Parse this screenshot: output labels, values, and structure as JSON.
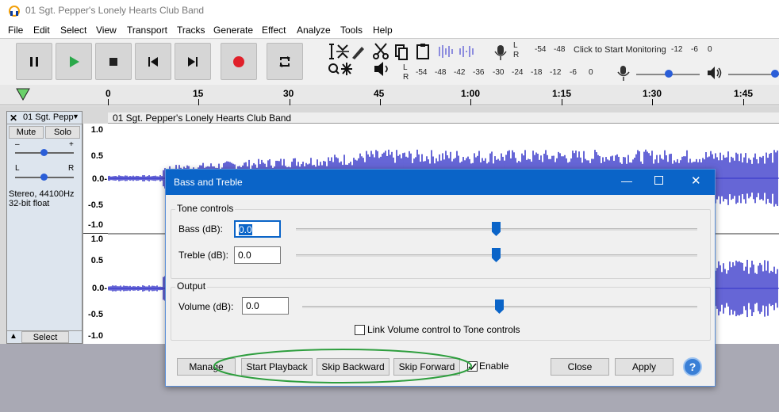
{
  "app": {
    "title": "01 Sgt. Pepper's Lonely Hearts Club Band"
  },
  "menu": [
    "File",
    "Edit",
    "Select",
    "View",
    "Transport",
    "Tracks",
    "Generate",
    "Effect",
    "Analyze",
    "Tools",
    "Help"
  ],
  "transport": {
    "pause": "pause-icon",
    "play": "play-icon",
    "stop": "stop-icon",
    "skip_start": "skip-to-start-icon",
    "skip_end": "skip-to-end-icon",
    "record": "record-icon",
    "loop": "loop-icon"
  },
  "meters": {
    "record_scale": [
      "L",
      "R",
      "-54",
      "-48"
    ],
    "monitor_text": "Click to Start Monitoring",
    "record_scale_right": [
      "-12",
      "-6",
      "0"
    ],
    "playback_scale": [
      "L",
      "R",
      "-54",
      "-48",
      "-42",
      "-36",
      "-30",
      "-24",
      "-18",
      "-12",
      "-6",
      "0"
    ]
  },
  "ruler": {
    "labels": [
      "0",
      "15",
      "30",
      "45",
      "1:00",
      "1:15",
      "1:30",
      "1:45"
    ]
  },
  "track": {
    "name": "01 Sgt. Pepp",
    "mute": "Mute",
    "solo": "Solo",
    "gain_minus": "–",
    "gain_plus": "+",
    "pan_l": "L",
    "pan_r": "R",
    "info_line1": "Stereo, 44100Hz",
    "info_line2": "32-bit float",
    "select": "Select",
    "clip_name": "01 Sgt. Pepper's Lonely Hearts Club Band",
    "scale_ch1": [
      "1.0",
      "0.5",
      "0.0-",
      "-0.5",
      "-1.0"
    ],
    "scale_ch2": [
      "1.0",
      "0.5",
      "0.0-",
      "-0.5",
      "-1.0"
    ]
  },
  "dialog": {
    "title": "Bass and Treble",
    "tone_group": "Tone controls",
    "bass_label": "Bass (dB):",
    "bass_value": "0.0",
    "treble_label": "Treble (dB):",
    "treble_value": "0.0",
    "output_group": "Output",
    "volume_label": "Volume (dB):",
    "volume_value": "0.0",
    "link_label": "Link Volume control to Tone controls",
    "link_checked": false,
    "manage": "Manage",
    "start_playback": "Start Playback",
    "skip_backward": "Skip Backward",
    "skip_forward": "Skip Forward",
    "enable_label": "Enable",
    "enable_checked": true,
    "close": "Close",
    "apply": "Apply",
    "help": "?"
  },
  "colors": {
    "waveform": "#3232c8",
    "accent": "#0a64c8",
    "highlight_ellipse": "#2e9e3e",
    "record": "#e0202a",
    "play": "#2aa84a"
  }
}
